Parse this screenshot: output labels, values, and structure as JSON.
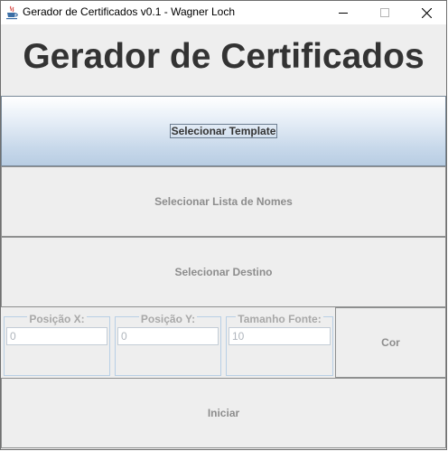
{
  "window": {
    "title": "Gerador de Certificados v0.1 - Wagner Loch",
    "icon": "java-cup-icon",
    "controls": [
      "minimize-icon",
      "maximize-icon",
      "close-icon"
    ]
  },
  "heading": "Gerador de Certificados",
  "buttons": {
    "select_template": "Selecionar Template",
    "select_names": "Selecionar Lista de Nomes",
    "select_destination": "Selecionar Destino",
    "color": "Cor",
    "start": "Iniciar"
  },
  "fields": {
    "pos_x": {
      "label": "Posição X:",
      "value": "0"
    },
    "pos_y": {
      "label": "Posição Y:",
      "value": "0"
    },
    "font_size": {
      "label": "Tamanho Fonte:",
      "value": "10"
    }
  },
  "colors": {
    "active_button_top": "#ffffff",
    "active_button_bottom": "#b8cde3",
    "disabled_text": "#8d8d8d",
    "panel_bg": "#eeeeee"
  }
}
